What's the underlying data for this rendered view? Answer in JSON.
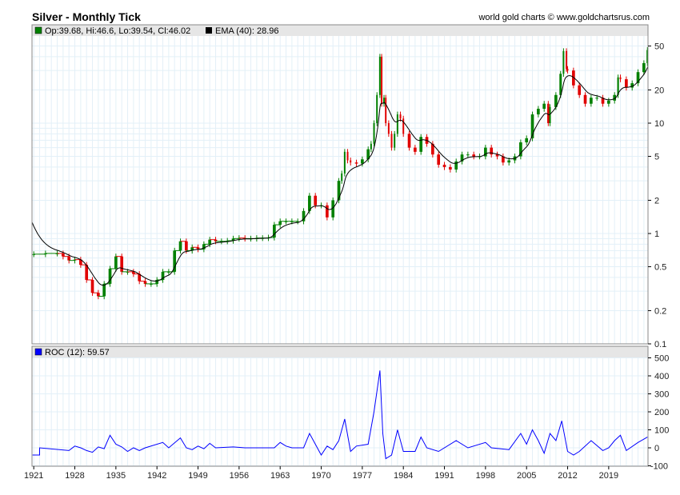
{
  "title": "Silver - Monthly Tick",
  "credit": "world gold charts © www.goldchartsrus.com",
  "colors": {
    "up": "#008000",
    "down": "#e00000",
    "ema": "#000000",
    "roc": "#0000ff",
    "grid": "#e3f0f8",
    "header": "#e6e6e6"
  },
  "chart_data": [
    {
      "type": "candlestick",
      "title": "Silver - Monthly Tick",
      "legend": [
        "Op:39.68, Hi:46.6, Lo:39.54, Cl:46.02",
        "EMA (40): 28.96"
      ],
      "y_scale": "log",
      "ylim": [
        0.1,
        60
      ],
      "y_ticks": [
        50,
        20,
        10,
        5,
        2,
        1,
        0.5,
        0.2,
        0.1
      ],
      "y_tick_labels": [
        "50",
        "20",
        "10",
        "5",
        "2",
        "1",
        "0.5",
        "0.2",
        "0.1"
      ],
      "xlim": [
        1920.7,
        2025.7
      ],
      "closes": [
        [
          1921,
          0.65
        ],
        [
          1923,
          0.66
        ],
        [
          1925,
          0.66
        ],
        [
          1926,
          0.62
        ],
        [
          1927,
          0.57
        ],
        [
          1928,
          0.58
        ],
        [
          1929,
          0.52
        ],
        [
          1930,
          0.38
        ],
        [
          1931,
          0.29
        ],
        [
          1932,
          0.27
        ],
        [
          1933,
          0.35
        ],
        [
          1934,
          0.48
        ],
        [
          1935,
          0.62
        ],
        [
          1936,
          0.45
        ],
        [
          1937,
          0.45
        ],
        [
          1938,
          0.43
        ],
        [
          1939,
          0.37
        ],
        [
          1940,
          0.35
        ],
        [
          1941,
          0.35
        ],
        [
          1942,
          0.38
        ],
        [
          1943,
          0.45
        ],
        [
          1944,
          0.45
        ],
        [
          1945,
          0.7
        ],
        [
          1946,
          0.85
        ],
        [
          1947,
          0.7
        ],
        [
          1948,
          0.75
        ],
        [
          1949,
          0.72
        ],
        [
          1950,
          0.8
        ],
        [
          1951,
          0.88
        ],
        [
          1952,
          0.85
        ],
        [
          1953,
          0.85
        ],
        [
          1954,
          0.86
        ],
        [
          1955,
          0.9
        ],
        [
          1956,
          0.91
        ],
        [
          1957,
          0.9
        ],
        [
          1958,
          0.9
        ],
        [
          1959,
          0.91
        ],
        [
          1960,
          0.91
        ],
        [
          1961,
          0.92
        ],
        [
          1962,
          1.2
        ],
        [
          1963,
          1.29
        ],
        [
          1964,
          1.29
        ],
        [
          1965,
          1.29
        ],
        [
          1966,
          1.29
        ],
        [
          1967,
          1.6
        ],
        [
          1968,
          2.2
        ],
        [
          1969,
          1.8
        ],
        [
          1970,
          1.8
        ],
        [
          1971,
          1.4
        ],
        [
          1972,
          2.0
        ],
        [
          1973,
          3.0
        ],
        [
          1973.5,
          3.5
        ],
        [
          1974,
          5.5
        ],
        [
          1974.5,
          4.6
        ],
        [
          1975,
          4.4
        ],
        [
          1976,
          4.3
        ],
        [
          1977,
          4.7
        ],
        [
          1978,
          5.8
        ],
        [
          1978.5,
          6.5
        ],
        [
          1979,
          10
        ],
        [
          1979.5,
          18
        ],
        [
          1980,
          40
        ],
        [
          1980.3,
          15
        ],
        [
          1980.7,
          17
        ],
        [
          1981,
          10
        ],
        [
          1981.5,
          8
        ],
        [
          1982,
          6
        ],
        [
          1982.5,
          8
        ],
        [
          1983,
          12
        ],
        [
          1983.5,
          11
        ],
        [
          1984,
          8
        ],
        [
          1985,
          6
        ],
        [
          1986,
          5.5
        ],
        [
          1987,
          7.5
        ],
        [
          1988,
          6.5
        ],
        [
          1989,
          5.2
        ],
        [
          1990,
          4.2
        ],
        [
          1991,
          4.0
        ],
        [
          1992,
          3.8
        ],
        [
          1993,
          4.5
        ],
        [
          1994,
          5.2
        ],
        [
          1995,
          5.2
        ],
        [
          1996,
          5.0
        ],
        [
          1997,
          5.0
        ],
        [
          1998,
          6.0
        ],
        [
          1999,
          5.2
        ],
        [
          2000,
          5.0
        ],
        [
          2001,
          4.4
        ],
        [
          2002,
          4.6
        ],
        [
          2003,
          5.0
        ],
        [
          2004,
          6.7
        ],
        [
          2005,
          7.3
        ],
        [
          2006,
          12
        ],
        [
          2007,
          13.5
        ],
        [
          2008,
          15
        ],
        [
          2008.7,
          10
        ],
        [
          2009,
          14
        ],
        [
          2010,
          18
        ],
        [
          2010.8,
          28
        ],
        [
          2011.3,
          45
        ],
        [
          2011.8,
          31
        ],
        [
          2012,
          30
        ],
        [
          2013,
          22
        ],
        [
          2014,
          18
        ],
        [
          2015,
          15
        ],
        [
          2016,
          17
        ],
        [
          2017,
          17
        ],
        [
          2018,
          15
        ],
        [
          2019,
          16
        ],
        [
          2020,
          18
        ],
        [
          2020.6,
          26
        ],
        [
          2021,
          25
        ],
        [
          2022,
          21
        ],
        [
          2023,
          23
        ],
        [
          2024,
          29
        ],
        [
          2025,
          35
        ],
        [
          2025.6,
          46.02
        ]
      ],
      "ema_period": 40,
      "ema_start": 1.3
    },
    {
      "type": "line",
      "legend": "ROC (12): 59.57",
      "ylim": [
        -100,
        500
      ],
      "y_ticks": [
        500,
        400,
        300,
        200,
        100,
        0,
        -100
      ],
      "y_tick_labels": [
        "500",
        "400",
        "300",
        "200",
        "100",
        "0",
        "-100"
      ],
      "x_ticks": [
        1921,
        1928,
        1935,
        1942,
        1949,
        1956,
        1963,
        1970,
        1977,
        1984,
        1991,
        1998,
        2005,
        2012,
        2019
      ],
      "x_tick_labels": [
        "1921",
        "1928",
        "1935",
        "1942",
        "1949",
        "1956",
        "1963",
        "1970",
        "1977",
        "1984",
        "1991",
        "1998",
        "2005",
        "2012",
        "2019"
      ],
      "points": [
        [
          1920.8,
          -40
        ],
        [
          1922,
          -40
        ],
        [
          1922,
          0
        ],
        [
          1927,
          -15
        ],
        [
          1928,
          10
        ],
        [
          1929,
          0
        ],
        [
          1930,
          -15
        ],
        [
          1931,
          -25
        ],
        [
          1932,
          5
        ],
        [
          1933,
          -5
        ],
        [
          1934,
          70
        ],
        [
          1935,
          20
        ],
        [
          1936,
          5
        ],
        [
          1937,
          -20
        ],
        [
          1938,
          0
        ],
        [
          1939,
          -15
        ],
        [
          1940,
          0
        ],
        [
          1943,
          30
        ],
        [
          1944,
          0
        ],
        [
          1946,
          55
        ],
        [
          1947,
          0
        ],
        [
          1948,
          -10
        ],
        [
          1949,
          10
        ],
        [
          1950,
          -5
        ],
        [
          1951,
          25
        ],
        [
          1952,
          0
        ],
        [
          1955,
          5
        ],
        [
          1957,
          0
        ],
        [
          1962,
          0
        ],
        [
          1963,
          30
        ],
        [
          1964,
          10
        ],
        [
          1965,
          0
        ],
        [
          1967,
          0
        ],
        [
          1968,
          80
        ],
        [
          1969,
          20
        ],
        [
          1970,
          -40
        ],
        [
          1971,
          10
        ],
        [
          1972,
          -10
        ],
        [
          1973,
          40
        ],
        [
          1974,
          160
        ],
        [
          1975,
          -20
        ],
        [
          1976,
          10
        ],
        [
          1978,
          20
        ],
        [
          1979,
          200
        ],
        [
          1980,
          430
        ],
        [
          1980.5,
          80
        ],
        [
          1981,
          -60
        ],
        [
          1982,
          -40
        ],
        [
          1983,
          100
        ],
        [
          1984,
          -20
        ],
        [
          1986,
          -20
        ],
        [
          1987,
          60
        ],
        [
          1988,
          0
        ],
        [
          1990,
          -20
        ],
        [
          1993,
          40
        ],
        [
          1995,
          0
        ],
        [
          1998,
          30
        ],
        [
          1999,
          0
        ],
        [
          2002,
          -10
        ],
        [
          2004,
          80
        ],
        [
          2005,
          20
        ],
        [
          2006,
          100
        ],
        [
          2007,
          40
        ],
        [
          2008,
          -30
        ],
        [
          2009,
          80
        ],
        [
          2010,
          40
        ],
        [
          2011,
          150
        ],
        [
          2012,
          -20
        ],
        [
          2013,
          -40
        ],
        [
          2014,
          -20
        ],
        [
          2016,
          40
        ],
        [
          2018,
          -15
        ],
        [
          2019,
          0
        ],
        [
          2020,
          40
        ],
        [
          2021,
          70
        ],
        [
          2022,
          -15
        ],
        [
          2024,
          30
        ],
        [
          2025.6,
          59.57
        ]
      ]
    }
  ]
}
